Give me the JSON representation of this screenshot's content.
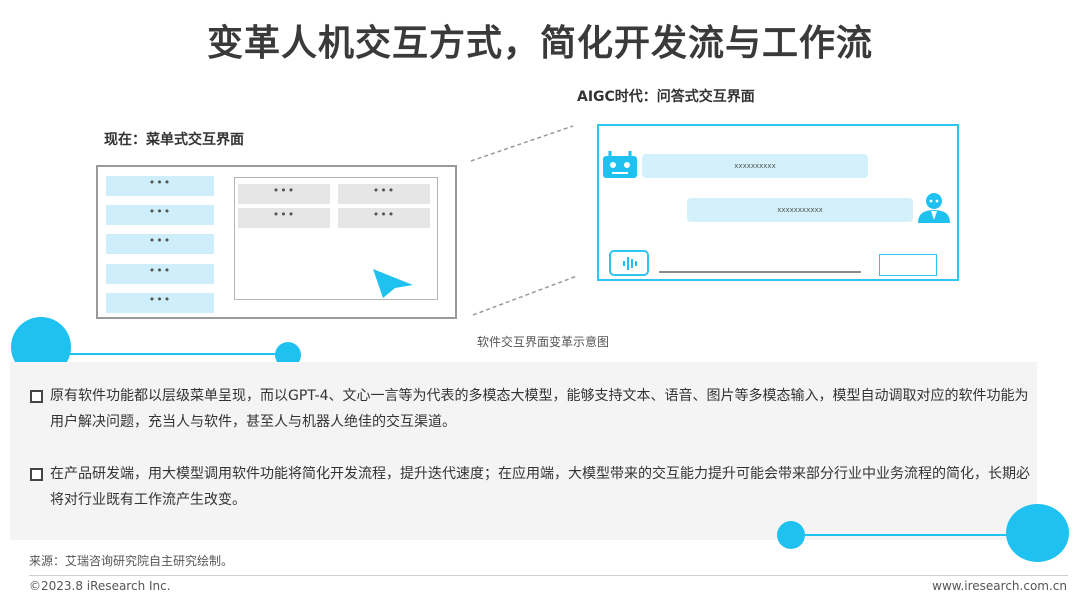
{
  "title": "变革人机交互方式，简化开发流与工作流",
  "current_label": "现在：菜单式交互界面",
  "aigc_label": "AIGC时代：问答式交互界面",
  "menu_items": [
    "•••",
    "•••",
    "•••",
    "•••",
    "•••"
  ],
  "content_cells": [
    "•••",
    "•••",
    "•••",
    "•••"
  ],
  "chat": {
    "bot_message": "xxxxxxxxxx",
    "user_message": "xxxxxxxxxxx"
  },
  "caption": "软件交互界面变革示意图",
  "bullets": [
    "原有软件功能都以层级菜单呈现，而以GPT-4、文心一言等为代表的多模态大模型，能够支持文本、语音、图片等多模态输入，模型自动调取对应的软件功能为用户解决问题，充当人与软件，甚至人与机器人绝佳的交互渠道。",
    "在产品研发端，用大模型调用软件功能将简化开发流程，提升迭代速度；在应用端，大模型带来的交互能力提升可能会带来部分行业中业务流程的简化，长期必将对行业既有工作流产生改变。"
  ],
  "source": "来源：艾瑞咨询研究院自主研究绘制。",
  "copyright": "©2023.8 iResearch Inc.",
  "website": "www.iresearch.com.cn",
  "colors": {
    "accent": "#1ec1ef",
    "bubble": "#d4f0fb",
    "menu_item": "#cfeefb",
    "panel_bg": "#f4f4f4"
  }
}
